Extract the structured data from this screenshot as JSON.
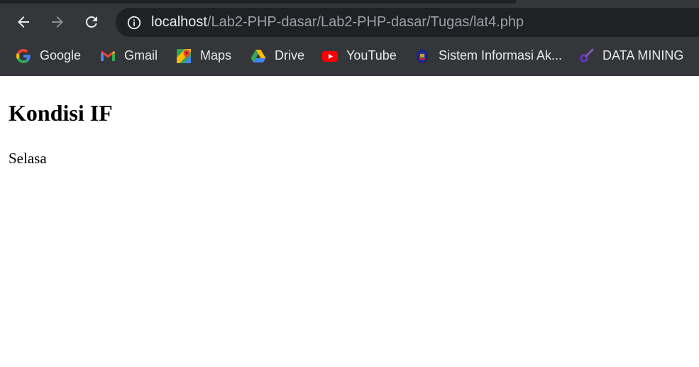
{
  "browser": {
    "address_bar": {
      "host": "localhost",
      "path": "/Lab2-PHP-dasar/Lab2-PHP-dasar/Tugas/lat4.php"
    },
    "bookmarks": [
      {
        "label": "Google",
        "icon": "google-icon"
      },
      {
        "label": "Gmail",
        "icon": "gmail-icon"
      },
      {
        "label": "Maps",
        "icon": "maps-icon"
      },
      {
        "label": "Drive",
        "icon": "drive-icon"
      },
      {
        "label": "YouTube",
        "icon": "youtube-icon"
      },
      {
        "label": "Sistem Informasi Ak...",
        "icon": "university-crest-icon"
      },
      {
        "label": "DATA MINING",
        "icon": "data-mining-icon"
      }
    ],
    "toolbar_color": "#35363a",
    "omnibox_color": "#202124"
  },
  "page": {
    "heading": "Kondisi IF",
    "text": "Selasa"
  }
}
